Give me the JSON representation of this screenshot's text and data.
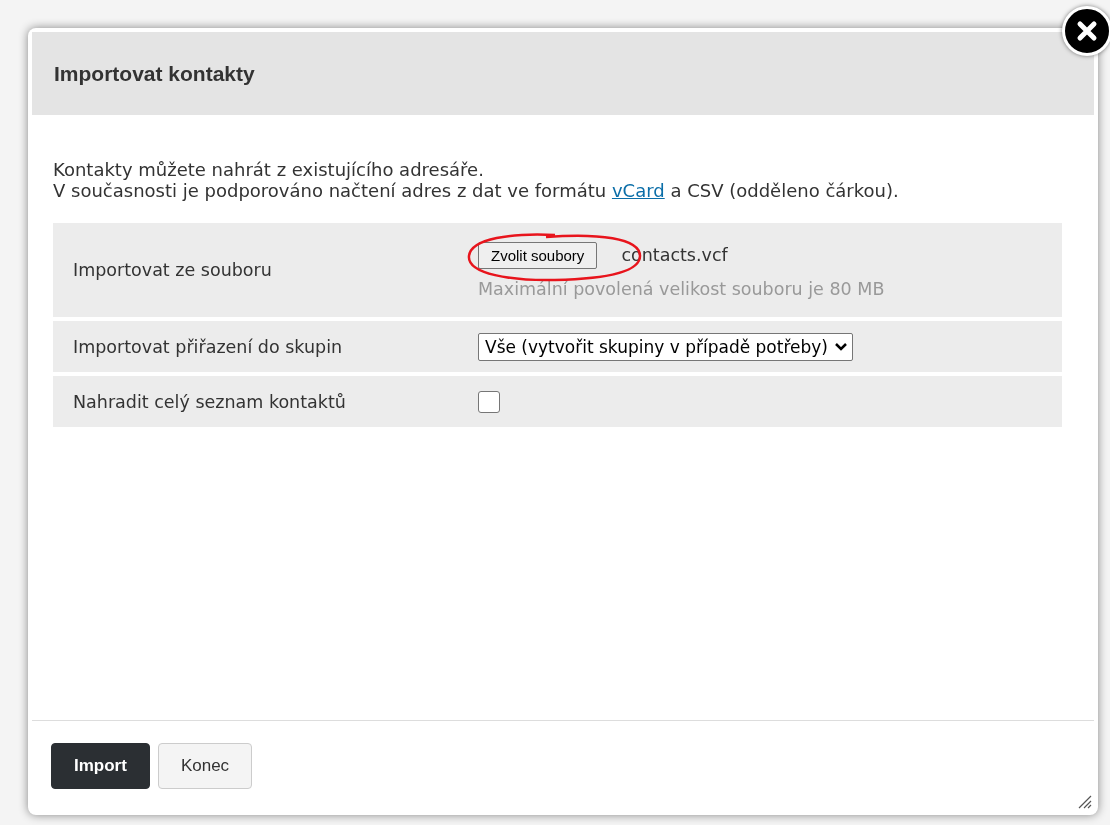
{
  "dialog": {
    "title": "Importovat kontakty",
    "intro": [
      "Kontakty můžete nahrát z existujícího adresáře.",
      "V současnosti je podporováno načtení adres z dat ve formátu "
    ],
    "intro_link": "vCard",
    "intro_tail": " a CSV (odděleno čárkou).",
    "rows": [
      {
        "kind": "file",
        "label": "Importovat ze souboru",
        "button": "Zvolit soubory",
        "file_name": "contacts.vcf",
        "hint": "Maximální povolená velikost souboru je 80 MB"
      },
      {
        "kind": "select",
        "label": "Importovat přiřazení do skupin",
        "value": "Vše (vytvořit skupiny v případě potřeby)"
      },
      {
        "kind": "checkbox",
        "label": "Nahradit celý seznam kontaktů",
        "checked": false
      }
    ],
    "buttons": [
      {
        "label": "Import",
        "primary": true
      },
      {
        "label": "Konec",
        "primary": false
      }
    ]
  }
}
